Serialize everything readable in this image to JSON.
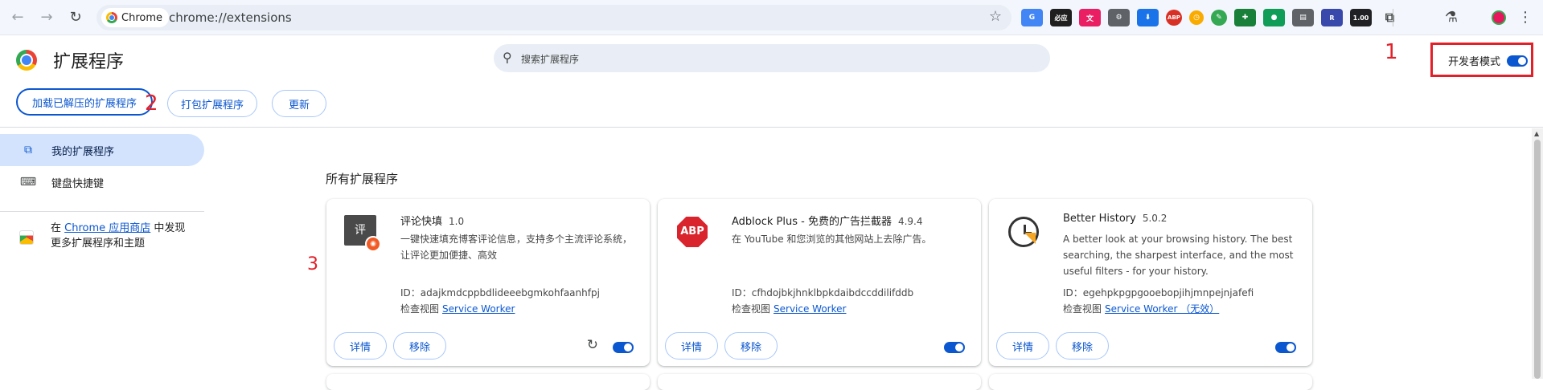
{
  "browser": {
    "site_chip": "Chrome",
    "url": "chrome://extensions",
    "toolbar_badges": [
      "必应",
      "1.00"
    ]
  },
  "header": {
    "title": "扩展程序",
    "search_placeholder": "搜索扩展程序",
    "developer_mode_label": "开发者模式",
    "developer_mode_on": true
  },
  "actions": {
    "load_unpacked": "加载已解压的扩展程序",
    "pack": "打包扩展程序",
    "update": "更新"
  },
  "annotations": {
    "a1": "1",
    "a2": "2",
    "a3": "3"
  },
  "sidebar": {
    "items": [
      {
        "label": "我的扩展程序",
        "icon": "extension-icon",
        "active": true
      },
      {
        "label": "键盘快捷键",
        "icon": "keyboard-icon",
        "active": false
      }
    ],
    "store_prefix": "在 ",
    "store_link": "Chrome 应用商店",
    "store_suffix": " 中发现更多扩展程序和主题"
  },
  "main": {
    "section_title": "所有扩展程序",
    "cards": [
      {
        "name": "评论快填",
        "version": "1.0",
        "description": "一键快速填充博客评论信息，支持多个主流评论系统，让评论更加便捷、高效",
        "id_label": "ID：",
        "id": "adajkmdcppbdlideeebgmkohfaanhfpj",
        "views_label": "检查视图",
        "view_link": "Service Worker",
        "details": "详情",
        "remove": "移除",
        "enabled": true,
        "has_reload": true,
        "icon": "comment-fill-icon"
      },
      {
        "name": "Adblock Plus - 免费的广告拦截器",
        "version": "4.9.4",
        "description": "在 YouTube 和您浏览的其他网站上去除广告。",
        "id_label": "ID：",
        "id": "cfhdojbkjhnklbpkdaibdccddilifddb",
        "views_label": "检查视图",
        "view_link": "Service Worker",
        "details": "详情",
        "remove": "移除",
        "enabled": true,
        "has_reload": false,
        "icon": "abp-icon"
      },
      {
        "name": "Better History",
        "version": "5.0.2",
        "description": "A better look at your browsing history. The best searching, the sharpest interface, and the most useful filters - for your history.",
        "id_label": "ID：",
        "id": "egehpkpgpgooebopjihjmnpejnjafefi",
        "views_label": "检查视图",
        "view_link": "Service Worker （无效）",
        "details": "详情",
        "remove": "移除",
        "enabled": true,
        "has_reload": false,
        "icon": "clock-history-icon"
      }
    ]
  },
  "colors": {
    "accent": "#0b57d0",
    "annotation_red": "#e2202a",
    "active_nav_bg": "#d3e3fd"
  }
}
